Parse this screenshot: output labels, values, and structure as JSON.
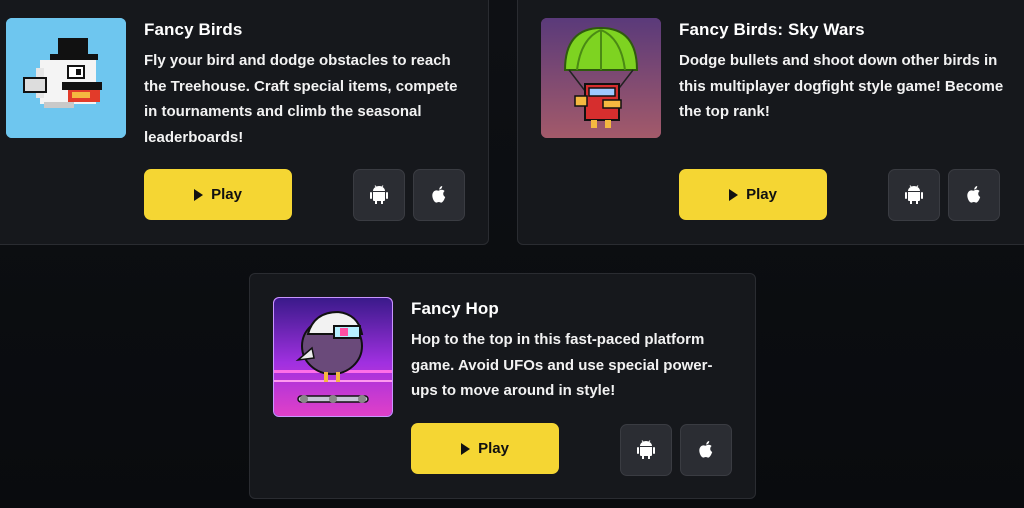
{
  "games": [
    {
      "title": "Fancy Birds",
      "description": "Fly your bird and dodge obstacles to reach the Treehouse. Craft special items, compete in tournaments and climb the seasonal leaderboards!",
      "play_label": "Play",
      "thumb_bg": "#67c2ee"
    },
    {
      "title": "Fancy Birds: Sky Wars",
      "description": "Dodge bullets and shoot down other birds in this multiplayer dogfight style game! Become the top rank!",
      "play_label": "Play",
      "thumb_bg": "#7d3d6b"
    },
    {
      "title": "Fancy Hop",
      "description": "Hop to the top in this fast-paced platform game. Avoid UFOs and use special power-ups to move around in style!",
      "play_label": "Play",
      "thumb_bg": "#8a2bd8"
    }
  ],
  "store_icons": [
    "android-icon",
    "apple-icon"
  ],
  "colors": {
    "accent": "#f5d633",
    "card_bg": "#16181c",
    "page_bg": "#0c0e12"
  }
}
